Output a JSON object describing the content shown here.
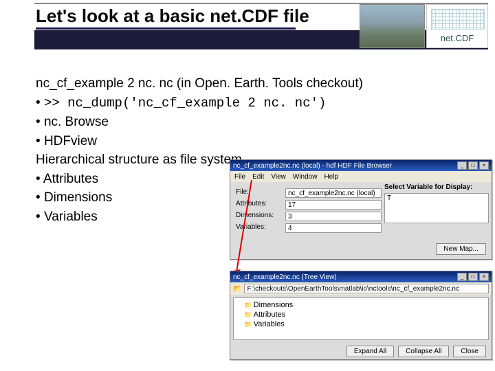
{
  "header": {
    "title": "Let's look at a basic net.CDF file",
    "logo_text": "net.CDF"
  },
  "content": {
    "intro": "nc_cf_example 2 nc. nc (in Open. Earth. Tools checkout)",
    "bullets1": [
      ">> nc_dump('nc_cf_example 2 nc. nc')",
      "nc. Browse",
      "HDFview"
    ],
    "hier": "Hierarchical structure as file system",
    "bullets2": [
      "Attributes",
      "Dimensions",
      "Variables"
    ]
  },
  "win1": {
    "title": "nc_cf_example2nc.nc (local) - hdf HDF File Browser",
    "menu": [
      "File",
      "Edit",
      "View",
      "Window",
      "Help"
    ],
    "rows": {
      "file_k": "File:",
      "file_v": "nc_cf_example2nc.nc (local)",
      "attr_k": "Attributes:",
      "attr_v": "17",
      "dim_k": "Dimensions:",
      "dim_v": "3",
      "var_k": "Variables:",
      "var_v": "4"
    },
    "right_label": "Select Variable for Display:",
    "right_item": "T",
    "new_map": "New Map..."
  },
  "win2": {
    "title": "nc_cf_example2nc.nc (Tree View)",
    "path_icon": "📂",
    "path": "F:\\checkouts\\OpenEarthTools\\matlab\\io\\nctools\\nc_cf_example2nc.nc",
    "tree": {
      "dims": "Dimensions",
      "attrs": "Attributes",
      "vars": "Variables"
    },
    "buttons": {
      "expand": "Expand All",
      "collapse": "Collapse All",
      "close": "Close"
    }
  },
  "win_ctrls": {
    "min": "_",
    "max": "□",
    "close": "×"
  }
}
